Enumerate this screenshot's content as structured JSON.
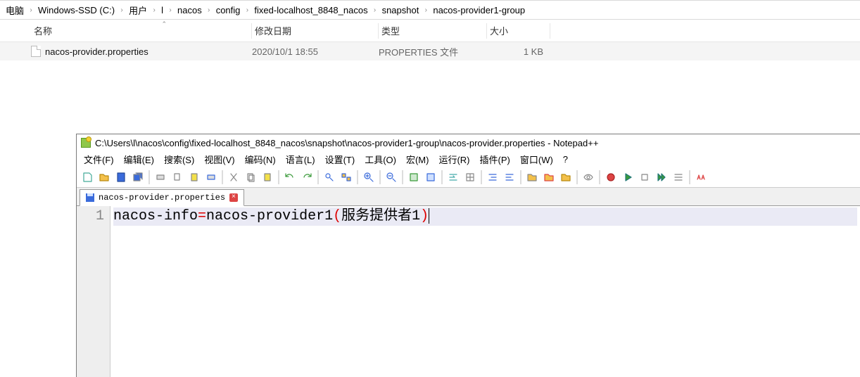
{
  "explorer": {
    "breadcrumb": [
      "电脑",
      "Windows-SSD (C:)",
      "用户",
      "l",
      "nacos",
      "config",
      "fixed-localhost_8848_nacos",
      "snapshot",
      "nacos-provider1-group"
    ],
    "columns": {
      "name": "名称",
      "date": "修改日期",
      "type": "类型",
      "size": "大小"
    },
    "rows": [
      {
        "name": "nacos-provider.properties",
        "date": "2020/10/1 18:55",
        "type": "PROPERTIES 文件",
        "size": "1 KB"
      }
    ]
  },
  "notepadpp": {
    "title": "C:\\Users\\l\\nacos\\config\\fixed-localhost_8848_nacos\\snapshot\\nacos-provider1-group\\nacos-provider.properties - Notepad++",
    "menu": [
      "文件(F)",
      "编辑(E)",
      "搜索(S)",
      "视图(V)",
      "编码(N)",
      "语言(L)",
      "设置(T)",
      "工具(O)",
      "宏(M)",
      "运行(R)",
      "插件(P)",
      "窗口(W)",
      "?"
    ],
    "tab": "nacos-provider.properties",
    "line_number": "1",
    "code": {
      "key": "nacos-info",
      "eq": "=",
      "val": "nacos-provider1",
      "lp": "(",
      "cjk": "服务提供者1",
      "rp": ")"
    },
    "toolbar_icons": [
      "new-file-icon",
      "open-file-icon",
      "save-icon",
      "save-all-icon",
      "sep",
      "print-icon",
      "copy-icon",
      "paste-icon",
      "print2-icon",
      "sep",
      "cut-icon",
      "copy2-icon",
      "paste2-icon",
      "sep",
      "undo-icon",
      "redo-icon",
      "sep",
      "find-icon",
      "replace-icon",
      "sep",
      "zoom-in-icon",
      "sep",
      "zoom-out-icon",
      "sep",
      "sync-icon",
      "sync2-icon",
      "sep",
      "wrap-icon",
      "show-all-icon",
      "sep",
      "indent-icon",
      "outdent-icon",
      "sep",
      "fold-icon",
      "unfold-icon",
      "folder-icon",
      "sep",
      "eye-icon",
      "sep",
      "record-icon",
      "play-icon",
      "stop-icon",
      "fast-icon",
      "list-icon",
      "sep",
      "spellcheck-icon"
    ]
  }
}
